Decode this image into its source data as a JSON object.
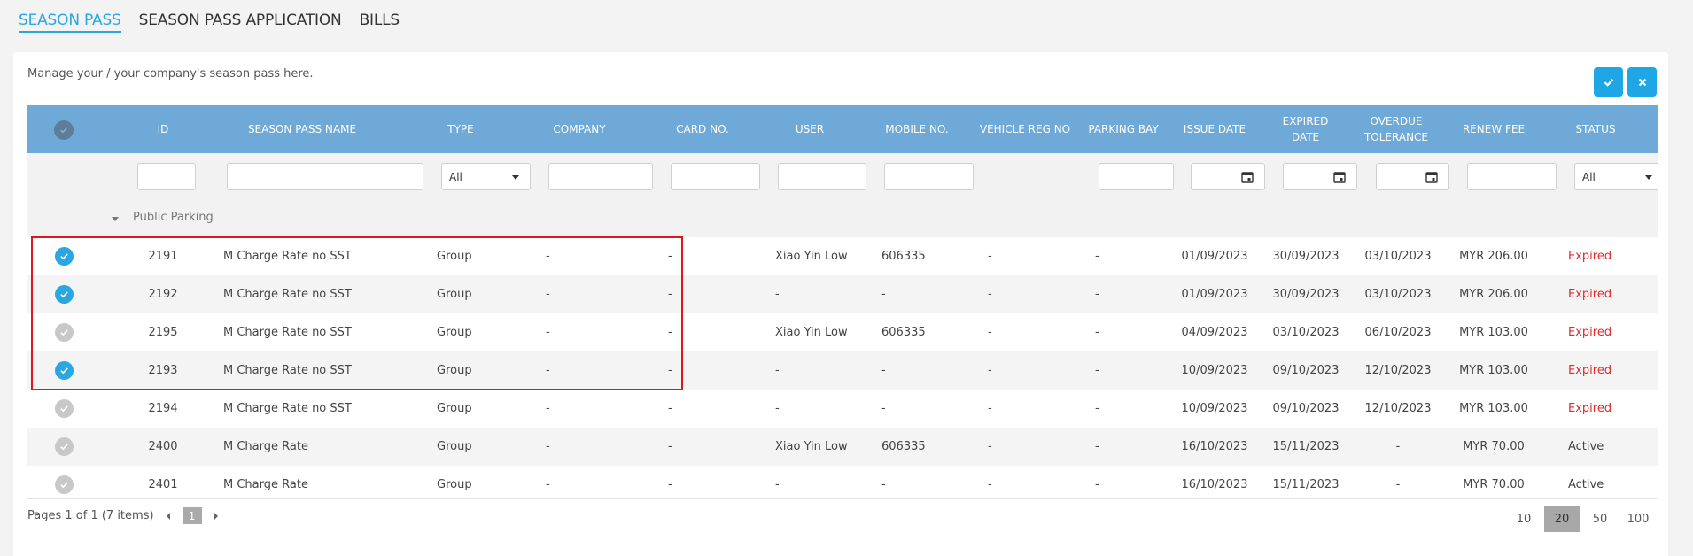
{
  "tabs": [
    {
      "label": "SEASON PASS",
      "active": true
    },
    {
      "label": "SEASON PASS APPLICATION",
      "active": false
    },
    {
      "label": "BILLS",
      "active": false
    }
  ],
  "panel": {
    "description": "Manage your / your company's season pass here.",
    "confirm_icon": "check-icon",
    "cancel_icon": "close-icon"
  },
  "grid": {
    "columns": [
      {
        "key": "id",
        "label": "ID"
      },
      {
        "key": "name",
        "label": "SEASON PASS NAME"
      },
      {
        "key": "type",
        "label": "TYPE"
      },
      {
        "key": "company",
        "label": "COMPANY"
      },
      {
        "key": "card",
        "label": "CARD NO."
      },
      {
        "key": "user",
        "label": "USER"
      },
      {
        "key": "mobile",
        "label": "MOBILE NO."
      },
      {
        "key": "vehicle",
        "label": "VEHICLE REG NO"
      },
      {
        "key": "bay",
        "label": "PARKING BAY"
      },
      {
        "key": "issue",
        "label": "ISSUE DATE"
      },
      {
        "key": "expired",
        "label": "EXPIRED DATE"
      },
      {
        "key": "overdue",
        "label": "OVERDUE TOLERANCE"
      },
      {
        "key": "fee",
        "label": "RENEW FEE"
      },
      {
        "key": "status",
        "label": "STATUS"
      }
    ],
    "filters": {
      "type_select": "All",
      "status_select": "All"
    },
    "group_label": "Public Parking",
    "rows": [
      {
        "checked": true,
        "id": "2191",
        "name": "M Charge Rate no SST",
        "type": "Group",
        "company": "-",
        "card": "-",
        "user": "Xiao Yin Low",
        "mobile": "606335",
        "vehicle": "-",
        "bay": "-",
        "issue": "01/09/2023",
        "expired": "30/09/2023",
        "overdue": "03/10/2023",
        "fee": "MYR 206.00",
        "status": "Expired"
      },
      {
        "checked": true,
        "id": "2192",
        "name": "M Charge Rate no SST",
        "type": "Group",
        "company": "-",
        "card": "-",
        "user": "-",
        "mobile": "-",
        "vehicle": "-",
        "bay": "-",
        "issue": "01/09/2023",
        "expired": "30/09/2023",
        "overdue": "03/10/2023",
        "fee": "MYR 206.00",
        "status": "Expired"
      },
      {
        "checked": false,
        "id": "2195",
        "name": "M Charge Rate no SST",
        "type": "Group",
        "company": "-",
        "card": "-",
        "user": "Xiao Yin Low",
        "mobile": "606335",
        "vehicle": "-",
        "bay": "-",
        "issue": "04/09/2023",
        "expired": "03/10/2023",
        "overdue": "06/10/2023",
        "fee": "MYR 103.00",
        "status": "Expired"
      },
      {
        "checked": true,
        "id": "2193",
        "name": "M Charge Rate no SST",
        "type": "Group",
        "company": "-",
        "card": "-",
        "user": "-",
        "mobile": "-",
        "vehicle": "-",
        "bay": "-",
        "issue": "10/09/2023",
        "expired": "09/10/2023",
        "overdue": "12/10/2023",
        "fee": "MYR 103.00",
        "status": "Expired"
      },
      {
        "checked": false,
        "id": "2194",
        "name": "M Charge Rate no SST",
        "type": "Group",
        "company": "-",
        "card": "-",
        "user": "-",
        "mobile": "-",
        "vehicle": "-",
        "bay": "-",
        "issue": "10/09/2023",
        "expired": "09/10/2023",
        "overdue": "12/10/2023",
        "fee": "MYR 103.00",
        "status": "Expired"
      },
      {
        "checked": false,
        "id": "2400",
        "name": "M Charge Rate",
        "type": "Group",
        "company": "-",
        "card": "-",
        "user": "Xiao Yin Low",
        "mobile": "606335",
        "vehicle": "-",
        "bay": "-",
        "issue": "16/10/2023",
        "expired": "15/11/2023",
        "overdue": "-",
        "fee": "MYR 70.00",
        "status": "Active"
      },
      {
        "checked": false,
        "id": "2401",
        "name": "M Charge Rate",
        "type": "Group",
        "company": "-",
        "card": "-",
        "user": "-",
        "mobile": "-",
        "vehicle": "-",
        "bay": "-",
        "issue": "16/10/2023",
        "expired": "15/11/2023",
        "overdue": "-",
        "fee": "MYR 70.00",
        "status": "Active"
      }
    ]
  },
  "pager": {
    "summary": "Pages 1 of 1 (7 items)",
    "current_page": "1",
    "page_sizes": [
      "10",
      "20",
      "50",
      "100"
    ],
    "active_size": "20"
  },
  "colors": {
    "accent": "#2aa7e0",
    "header": "#6fa9d8",
    "expired": "#e02a2a",
    "highlight": "#e4141f"
  }
}
